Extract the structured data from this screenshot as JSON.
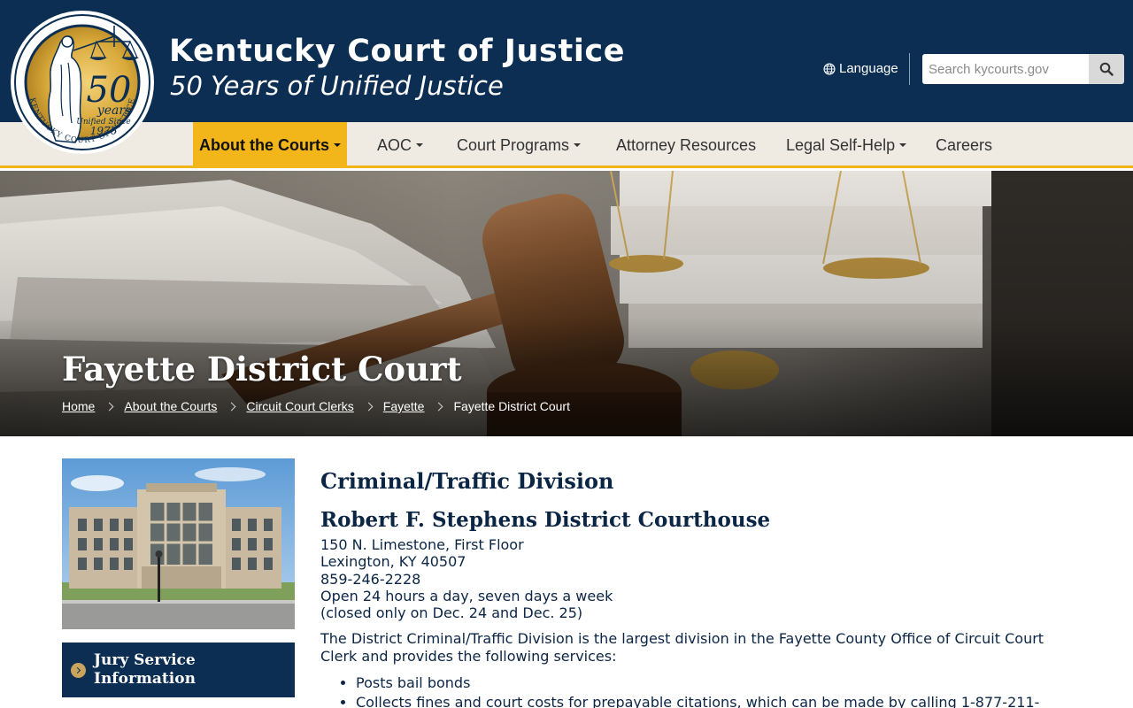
{
  "header": {
    "title": "Kentucky Court of Justice",
    "tagline": "50 Years of Unified Justice",
    "logo": {
      "years_number": "50",
      "years_word": "years",
      "unified_since": "Unified Since",
      "since_year": "1976",
      "ring_text": "KENTUCKY COURT OF JUSTICE"
    },
    "language_label": "Language",
    "search_placeholder": "Search kycourts.gov"
  },
  "nav": {
    "items": [
      {
        "label": "About the Courts",
        "dropdown": true,
        "active": true
      },
      {
        "label": "AOC",
        "dropdown": true
      },
      {
        "label": "Court Programs",
        "dropdown": true
      },
      {
        "label": "Attorney Resources",
        "dropdown": false
      },
      {
        "label": "Legal Self-Help",
        "dropdown": true
      },
      {
        "label": "Careers",
        "dropdown": false
      }
    ]
  },
  "hero": {
    "title": "Fayette District Court",
    "breadcrumb": [
      "Home",
      "About the Courts",
      "Circuit Court Clerks",
      "Fayette",
      "Fayette District Court"
    ]
  },
  "sidebar": {
    "photo_icon": "courthouse-photo",
    "jury_link_line1": "Jury Service",
    "jury_link_line2": "Information"
  },
  "main": {
    "division_heading": "Criminal/Traffic Division",
    "courthouse_heading": "Robert F. Stephens District Courthouse",
    "address": [
      "150 N. Limestone, First Floor",
      "Lexington, KY 40507",
      "859-246-2228",
      "Open 24 hours a day, seven days a week",
      "(closed only on Dec. 24 and Dec. 25)"
    ],
    "intro": "The District Criminal/Traffic Division is the largest division in the Fayette County Office of Circuit Court Clerk and provides the following services:",
    "services": [
      "Posts bail bonds",
      "Collects fines and court costs for prepayable citations, which can be made by calling 1-877-211-"
    ]
  },
  "colors": {
    "navy": "#0b2e52",
    "gold": "#f2b51a",
    "nav_bg": "#efebe3"
  }
}
